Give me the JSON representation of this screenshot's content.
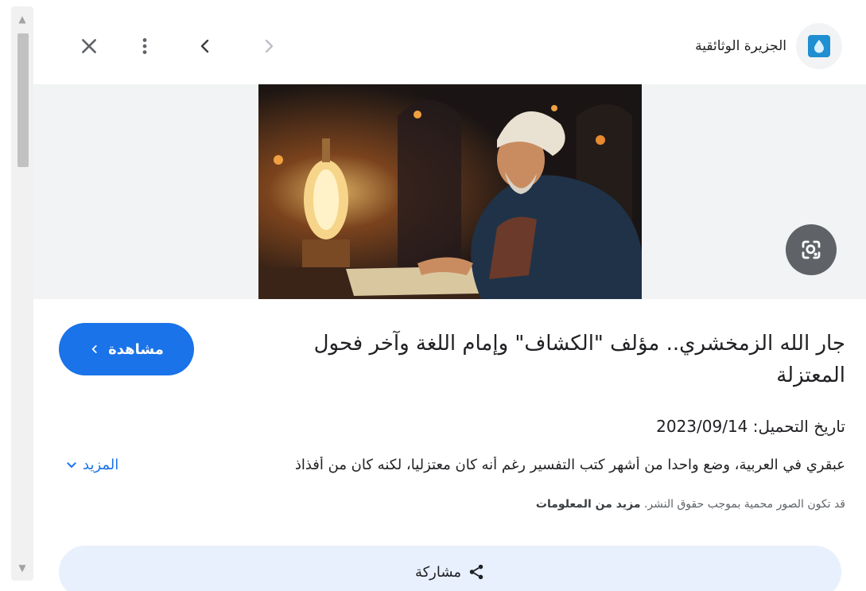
{
  "topbar": {
    "source_name": "الجزيرة الوثائقية"
  },
  "image": {
    "description_alt": "illustration"
  },
  "content": {
    "title": "جار الله الزمخشري.. مؤلف \"الكشاف\" وإمام اللغة وآخر فحول المعتزلة",
    "watch_label": "مشاهدة",
    "upload_date": "تاريخ التحميل: 2023/09/14",
    "description": "عبقري في العربية، وضع واحدا من أشهر كتب التفسير رغم أنه كان معتزليا، لكنه كان من أفذاذ",
    "more_label": "المزيد",
    "copyright_text": "قد تكون الصور محمية بموجب حقوق النشر.",
    "copyright_link": "مزيد من المعلومات",
    "share_label": "مشاركة"
  },
  "colors": {
    "accent": "#1a73e8",
    "share_bg": "#e8f0fe",
    "lens_bg": "#5f6368"
  }
}
